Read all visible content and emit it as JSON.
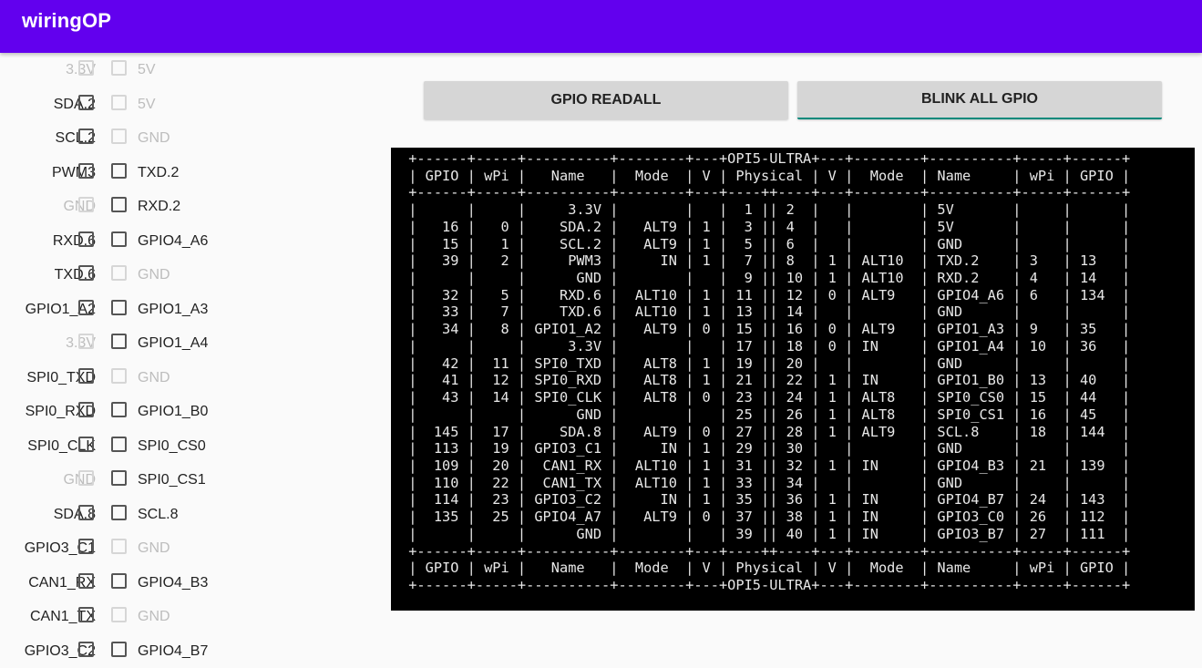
{
  "app": {
    "title": "wiringOP"
  },
  "buttons": {
    "readall": "GPIO READALL",
    "blink": "BLINK ALL GPIO"
  },
  "pins": [
    {
      "left": "3.3V",
      "left_enabled": false,
      "right": "5V",
      "right_enabled": false
    },
    {
      "left": "SDA.2",
      "left_enabled": true,
      "right": "5V",
      "right_enabled": false
    },
    {
      "left": "SCL.2",
      "left_enabled": true,
      "right": "GND",
      "right_enabled": false
    },
    {
      "left": "PWM3",
      "left_enabled": true,
      "right": "TXD.2",
      "right_enabled": true
    },
    {
      "left": "GND",
      "left_enabled": false,
      "right": "RXD.2",
      "right_enabled": true
    },
    {
      "left": "RXD.6",
      "left_enabled": true,
      "right": "GPIO4_A6",
      "right_enabled": true
    },
    {
      "left": "TXD.6",
      "left_enabled": true,
      "right": "GND",
      "right_enabled": false
    },
    {
      "left": "GPIO1_A2",
      "left_enabled": true,
      "right": "GPIO1_A3",
      "right_enabled": true
    },
    {
      "left": "3.3V",
      "left_enabled": false,
      "right": "GPIO1_A4",
      "right_enabled": true
    },
    {
      "left": "SPI0_TXD",
      "left_enabled": true,
      "right": "GND",
      "right_enabled": false
    },
    {
      "left": "SPI0_RXD",
      "left_enabled": true,
      "right": "GPIO1_B0",
      "right_enabled": true
    },
    {
      "left": "SPI0_CLK",
      "left_enabled": true,
      "right": "SPI0_CS0",
      "right_enabled": true
    },
    {
      "left": "GND",
      "left_enabled": false,
      "right": "SPI0_CS1",
      "right_enabled": true
    },
    {
      "left": "SDA.8",
      "left_enabled": true,
      "right": "SCL.8",
      "right_enabled": true
    },
    {
      "left": "GPIO3_C1",
      "left_enabled": true,
      "right": "GND",
      "right_enabled": false
    },
    {
      "left": "CAN1_RX",
      "left_enabled": true,
      "right": "GPIO4_B3",
      "right_enabled": true
    },
    {
      "left": "CAN1_TX",
      "left_enabled": true,
      "right": "GND",
      "right_enabled": false
    },
    {
      "left": "GPIO3_C2",
      "left_enabled": true,
      "right": "GPIO4_B7",
      "right_enabled": true
    }
  ],
  "terminal": {
    "lines": [
      " +------+-----+----------+--------+---+OPI5-ULTRA+---+--------+----------+-----+------+",
      " | GPIO | wPi |   Name   |  Mode  | V | Physical | V |  Mode  | Name     | wPi | GPIO |",
      " +------+-----+----------+--------+---+----++----+---+--------+----------+-----+------+",
      " |      |     |     3.3V |        |   |  1 || 2  |   |        | 5V       |     |      |",
      " |   16 |   0 |    SDA.2 |   ALT9 | 1 |  3 || 4  |   |        | 5V       |     |      |",
      " |   15 |   1 |    SCL.2 |   ALT9 | 1 |  5 || 6  |   |        | GND      |     |      |",
      " |   39 |   2 |     PWM3 |     IN | 1 |  7 || 8  | 1 | ALT10  | TXD.2    | 3   | 13   |",
      " |      |     |      GND |        |   |  9 || 10 | 1 | ALT10  | RXD.2    | 4   | 14   |",
      " |   32 |   5 |    RXD.6 |  ALT10 | 1 | 11 || 12 | 0 | ALT9   | GPIO4_A6 | 6   | 134  |",
      " |   33 |   7 |    TXD.6 |  ALT10 | 1 | 13 || 14 |   |        | GND      |     |      |",
      " |   34 |   8 | GPIO1_A2 |   ALT9 | 0 | 15 || 16 | 0 | ALT9   | GPIO1_A3 | 9   | 35   |",
      " |      |     |     3.3V |        |   | 17 || 18 | 0 | IN     | GPIO1_A4 | 10  | 36   |",
      " |   42 |  11 | SPI0_TXD |   ALT8 | 1 | 19 || 20 |   |        | GND      |     |      |",
      " |   41 |  12 | SPI0_RXD |   ALT8 | 1 | 21 || 22 | 1 | IN     | GPIO1_B0 | 13  | 40   |",
      " |   43 |  14 | SPI0_CLK |   ALT8 | 0 | 23 || 24 | 1 | ALT8   | SPI0_CS0 | 15  | 44   |",
      " |      |     |      GND |        |   | 25 || 26 | 1 | ALT8   | SPI0_CS1 | 16  | 45   |",
      " |  145 |  17 |    SDA.8 |   ALT9 | 0 | 27 || 28 | 1 | ALT9   | SCL.8    | 18  | 144  |",
      " |  113 |  19 | GPIO3_C1 |     IN | 1 | 29 || 30 |   |        | GND      |     |      |",
      " |  109 |  20 |  CAN1_RX |  ALT10 | 1 | 31 || 32 | 1 | IN     | GPIO4_B3 | 21  | 139  |",
      " |  110 |  22 |  CAN1_TX |  ALT10 | 1 | 33 || 34 |   |        | GND      |     |      |",
      " |  114 |  23 | GPIO3_C2 |     IN | 1 | 35 || 36 | 1 | IN     | GPIO4_B7 | 24  | 143  |",
      " |  135 |  25 | GPIO4_A7 |   ALT9 | 0 | 37 || 38 | 1 | IN     | GPIO3_C0 | 26  | 112  |",
      " |      |     |      GND |        |   | 39 || 40 | 1 | IN     | GPIO3_B7 | 27  | 111  |",
      " +------+-----+----------+--------+---+----++----+---+--------+----------+-----+------+",
      " | GPIO | wPi |   Name   |  Mode  | V | Physical | V |  Mode  | Name     | wPi | GPIO |",
      " +------+-----+----------+--------+---+OPI5-ULTRA+---+--------+----------+-----+------+"
    ]
  }
}
